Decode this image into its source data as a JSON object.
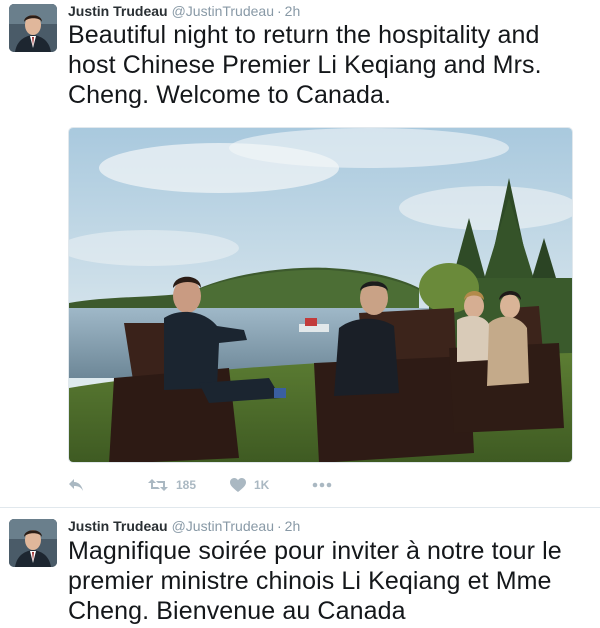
{
  "tweets": [
    {
      "fullname": "Justin Trudeau",
      "username": "@JustinTrudeau",
      "separator": "·",
      "time": "2h",
      "text": "Beautiful night to return the hospitality and host Chinese Premier Li Keqiang and Mrs. Cheng. Welcome to Canada.",
      "actions": {
        "retweets": "185",
        "likes": "1K"
      }
    },
    {
      "fullname": "Justin Trudeau",
      "username": "@JustinTrudeau",
      "separator": "·",
      "time": "2h",
      "text": "Magnifique soirée pour inviter à notre tour le premier ministre chinois Li Keqiang et Mme Cheng. Bienvenue au Canada"
    }
  ],
  "icons": {
    "reply": "reply-icon",
    "retweet": "retweet-icon",
    "like": "heart-icon",
    "more": "more-icon"
  },
  "colors": {
    "action_gray": "#aab8c2",
    "meta_gray": "#8899a6",
    "border": "#e1e8ed",
    "top_accent": "#e0245e"
  }
}
